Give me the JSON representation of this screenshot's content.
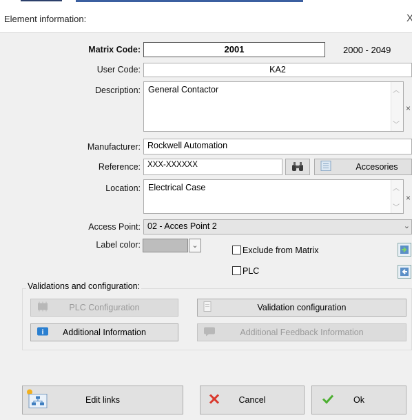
{
  "window": {
    "title": "Element information:",
    "close_glyph": "X"
  },
  "matrix_code": {
    "label": "Matrix Code:",
    "value": "2001",
    "range": "2000 - 2049"
  },
  "user_code": {
    "label": "User Code:",
    "value": "KA2"
  },
  "description": {
    "label": "Description:",
    "value": "General Contactor"
  },
  "manufacturer": {
    "label": "Manufacturer:",
    "value": "Rockwell Automation"
  },
  "reference": {
    "label": "Reference:",
    "value": "XXX-XXXXXX",
    "accessories_label": "Accesories"
  },
  "location": {
    "label": "Location:",
    "value": "Electrical Case"
  },
  "access_point": {
    "label": "Access Point:",
    "value": "02 - Acces Point 2"
  },
  "label_color": {
    "label": "Label color:",
    "swatch": "#bdbdbd"
  },
  "exclude_from_matrix": {
    "label": "Exclude from Matrix",
    "checked": false
  },
  "plc_checkbox": {
    "label": "PLC",
    "checked": false
  },
  "validations": {
    "title": "Validations and configuration:",
    "plc_configuration": "PLC Configuration",
    "validation_configuration": "Validation configuration",
    "additional_information": "Additional Information",
    "additional_feedback": "Additional Feedback Information"
  },
  "footer": {
    "edit_links": "Edit links",
    "cancel": "Cancel",
    "ok": "Ok"
  },
  "colors": {
    "cancel_icon": "#d9382c",
    "ok_icon": "#4caf30",
    "info_icon": "#2a7fd0"
  }
}
